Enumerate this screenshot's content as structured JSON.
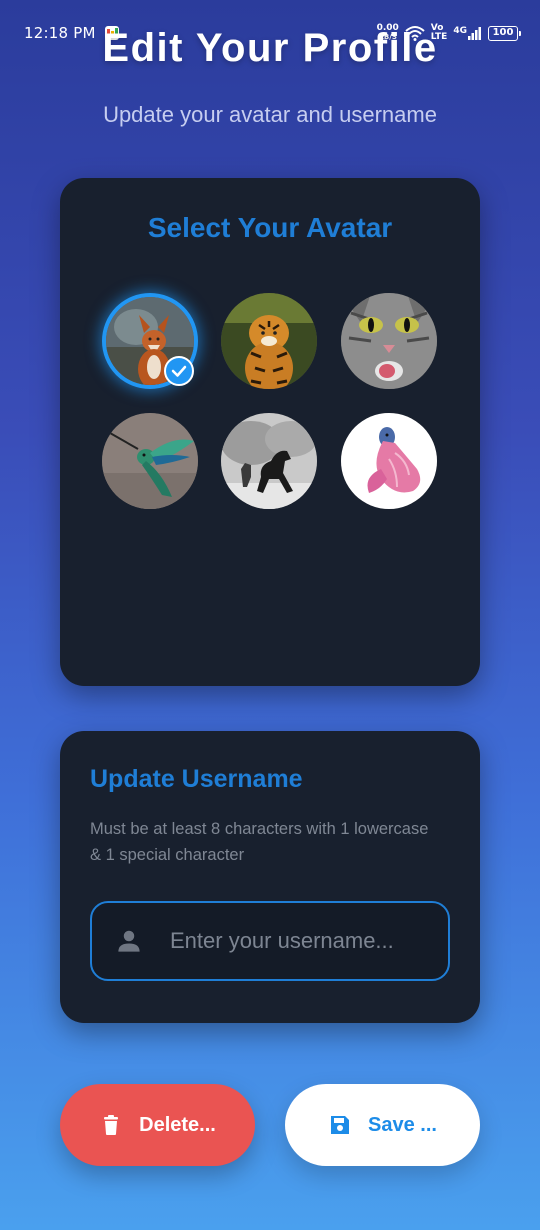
{
  "status_bar": {
    "time": "12:18 PM",
    "net_speed_value": "0.00",
    "net_speed_unit": "KB/S",
    "volte_top": "Vo",
    "volte_bottom": "LTE",
    "network": "4G",
    "battery": "100"
  },
  "header": {
    "title": "Edit Your Profile",
    "subtitle": "Update your avatar and username"
  },
  "avatar_section": {
    "title": "Select Your Avatar",
    "selected_index": 0,
    "avatars": [
      {
        "name": "fox",
        "icon": "fox-avatar"
      },
      {
        "name": "tiger",
        "icon": "tiger-avatar"
      },
      {
        "name": "cat",
        "icon": "cat-avatar"
      },
      {
        "name": "hummingbird",
        "icon": "hummingbird-avatar"
      },
      {
        "name": "horse",
        "icon": "horse-avatar"
      },
      {
        "name": "betta fish",
        "icon": "fish-avatar"
      }
    ]
  },
  "username_section": {
    "title": "Update Username",
    "hint": "Must be at least 8 characters with 1 lowercase & 1 special character",
    "input_placeholder": "Enter your username...",
    "input_value": ""
  },
  "actions": {
    "delete_label": "Delete...",
    "save_label": "Save ..."
  },
  "colors": {
    "accent": "#1f7ed6",
    "card_bg": "#18202e",
    "delete": "#ea5452",
    "save_text": "#1d8ce8"
  }
}
